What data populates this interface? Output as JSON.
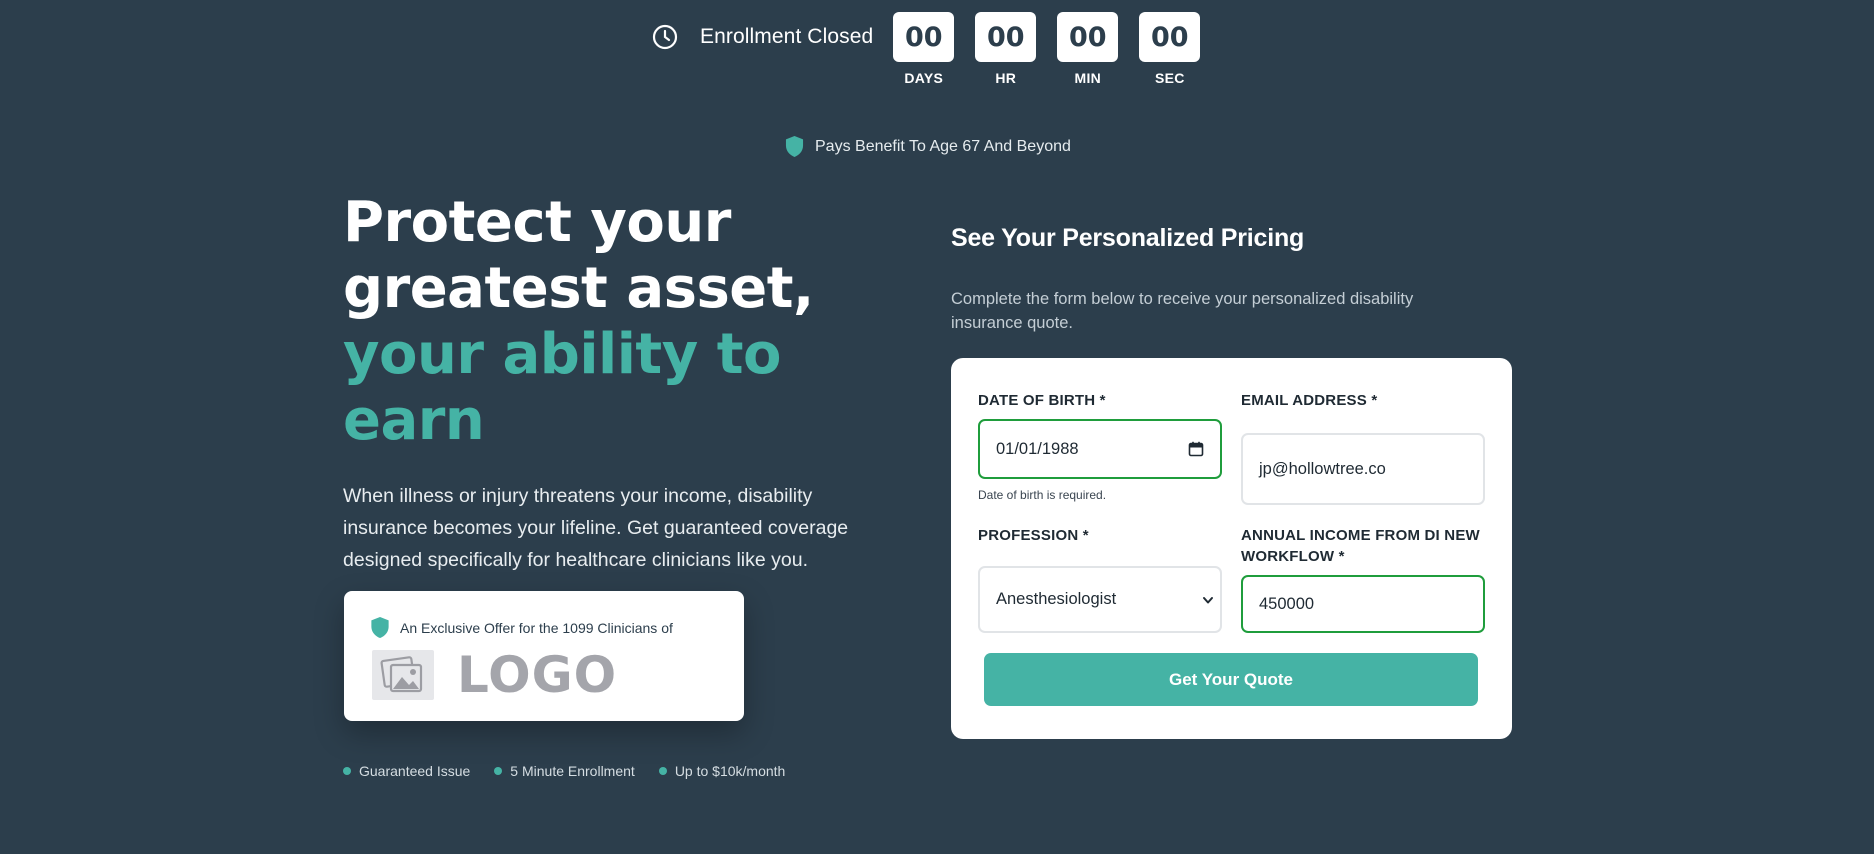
{
  "countdown": {
    "status": "Enrollment Closed",
    "units": [
      {
        "value": "00",
        "label": "DAYS"
      },
      {
        "value": "00",
        "label": "HR"
      },
      {
        "value": "00",
        "label": "MIN"
      },
      {
        "value": "00",
        "label": "SEC"
      }
    ]
  },
  "benefit": {
    "text": "Pays Benefit To Age 67 And Beyond"
  },
  "hero": {
    "title_lines": [
      "Protect your",
      "greatest asset,"
    ],
    "title_accent_lines": [
      "your ability to",
      "earn"
    ],
    "description": "When illness or injury threatens your income, disability insurance becomes your lifeline. Get guaranteed coverage designed specifically for healthcare clinicians like you."
  },
  "offer": {
    "text": "An Exclusive Offer for the 1099 Clinicians of",
    "logo_text": "LOGO"
  },
  "features": [
    "Guaranteed Issue",
    "5 Minute Enrollment",
    "Up to $10k/month"
  ],
  "form": {
    "title": "See Your Personalized Pricing",
    "subtitle": "Complete the form below to receive your personalized disability insurance quote.",
    "dob": {
      "label": "DATE OF BIRTH *",
      "value": "01/01/1988",
      "error": "Date of birth is required."
    },
    "email": {
      "label": "EMAIL ADDRESS *",
      "value": "jp@hollowtree.co"
    },
    "profession": {
      "label": "PROFESSION *",
      "value": "Anesthesiologist"
    },
    "income": {
      "label": "ANNUAL INCOME FROM DI NEW WORKFLOW *",
      "value": "450000"
    },
    "submit_label": "Get Your Quote"
  },
  "colors": {
    "background": "#2c3e4c",
    "accent": "#45b3a5",
    "valid_border": "#1f9d3c",
    "card": "#ffffff"
  },
  "icons": [
    "clock-icon",
    "shield-icon",
    "image-icon",
    "calendar-icon",
    "chevron-down-icon"
  ]
}
